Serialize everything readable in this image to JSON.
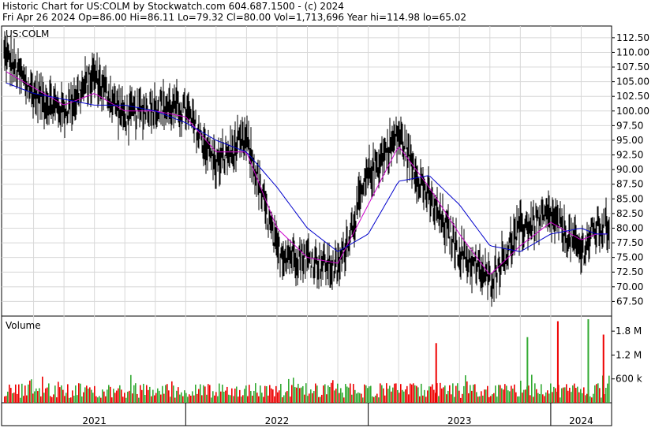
{
  "header": {
    "line1": "Historic Chart for US:COLM by Stockwatch.com 604.687.1500 - (c) 2024",
    "line2": "Fri Apr 26 2024   Op=86.00   Hi=86.11   Lo=79.32   Cl=80.00   Vol=1,713,696   Year hi=114.98   lo=65.02"
  },
  "colors": {
    "price": "#000000",
    "ma_short": "#cc00cc",
    "ma_long": "#0000cc",
    "vol_up": "#33aa33",
    "vol_down": "#ee0000",
    "grid": "#d8d8d8"
  },
  "chart_data": [
    {
      "type": "line",
      "title": "US:COLM",
      "ylim": [
        65.0,
        114.5
      ],
      "y_ticks": [
        "112.50",
        "110.00",
        "107.50",
        "105.00",
        "102.50",
        "100.00",
        "97.50",
        "95.00",
        "92.50",
        "90.00",
        "87.50",
        "85.00",
        "82.50",
        "80.00",
        "77.50",
        "75.00",
        "72.50",
        "70.00",
        "67.50"
      ],
      "grid": true,
      "x": [
        "2021-01",
        "2021-03",
        "2021-05",
        "2021-07",
        "2021-09",
        "2021-11",
        "2022-01",
        "2022-03",
        "2022-05",
        "2022-07",
        "2022-09",
        "2022-11",
        "2023-01",
        "2023-03",
        "2023-05",
        "2023-07",
        "2023-09",
        "2023-11",
        "2024-01",
        "2024-03",
        "2024-04"
      ],
      "series": [
        {
          "values": [
            110,
            103,
            100,
            106,
            99,
            101,
            100,
            91,
            95,
            76,
            75,
            73,
            89,
            96,
            85,
            76,
            71,
            80,
            82,
            76,
            80
          ]
        },
        {
          "values": [
            107,
            104,
            101,
            103,
            100,
            100,
            99,
            93,
            93,
            80,
            75,
            74,
            84,
            94,
            87,
            79,
            72,
            77,
            81,
            78,
            79
          ]
        },
        {
          "values": [
            105,
            103,
            102,
            101,
            101,
            100,
            98,
            95,
            93,
            87,
            80,
            76,
            79,
            88,
            89,
            84,
            77,
            76,
            79,
            80,
            79
          ]
        }
      ]
    },
    {
      "type": "bar",
      "title": "Volume",
      "ylim": [
        0,
        2100000
      ],
      "y_ticks": [
        "1.8 M",
        "1.2 M",
        "600 k"
      ],
      "x_labels": [
        "2021",
        "2022",
        "2023",
        "2024"
      ],
      "spikes": [
        {
          "date": "2023-05",
          "value": 1500000
        },
        {
          "date": "2023-11",
          "value": 1650000
        },
        {
          "date": "2024-01",
          "value": 2050000
        },
        {
          "date": "2024-03",
          "value": 2100000
        },
        {
          "date": "2024-04",
          "value": 1713696
        }
      ]
    }
  ]
}
